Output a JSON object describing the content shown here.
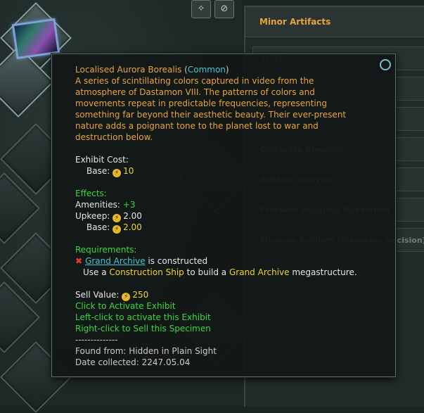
{
  "panel": {
    "header": "Minor Artifacts",
    "items": [
      "??????",
      "",
      "",
      "Celebrate Diversity",
      "Artifact Analysis",
      "Proclaim Religious Revelation",
      "Museum Exhibits (Planetary Decision)"
    ]
  },
  "toolbar": {
    "icon1": "✧",
    "icon2": "⊘"
  },
  "tooltip": {
    "title": "Localised Aurora Borealis",
    "rarity": "Common",
    "description": [
      "A series of scintillating colors captured in video from the",
      "atmosphere of Dastamon VIII. The patterns of colors and",
      "movements repeat in predictable frequencies, representing",
      "something far beyond their aesthetic beauty. Their ever-present",
      "nature adds a poignant tone to the planet lost to war and",
      "destruction below."
    ],
    "exhibit_cost_label": "Exhibit Cost:",
    "base_label": "Base:",
    "exhibit_cost_value": "10",
    "effects_label": "Effects:",
    "amenities_label": "Amenities:",
    "amenities_value": "+3",
    "upkeep_label": "Upkeep:",
    "upkeep_value": "2.00",
    "upkeep_base_value": "2.00",
    "requirements_label": "Requirements:",
    "req_link": "Grand Archive",
    "req_suffix": " is constructed",
    "req2_prefix": "Use a ",
    "req2_ship": "Construction Ship",
    "req2_mid": " to build a ",
    "req2_struct": "Grand Archive",
    "req2_suffix": " megastructure.",
    "sell_label": "Sell Value:",
    "sell_value": "250",
    "click_activate": "Click to Activate Exhibit",
    "left_click": "Left-click to activate this Exhibit",
    "right_click": "Right-click to Sell this Specimen",
    "separator": "--------------",
    "found_from": "Found from: Hidden in Plain Sight",
    "date_collected": "Date collected: 2247.05.04"
  },
  "colors": {
    "accent_orange": "#e8a43a",
    "cyan": "#49c3cf",
    "green": "#39d63e",
    "yellow": "#f2d22a"
  }
}
